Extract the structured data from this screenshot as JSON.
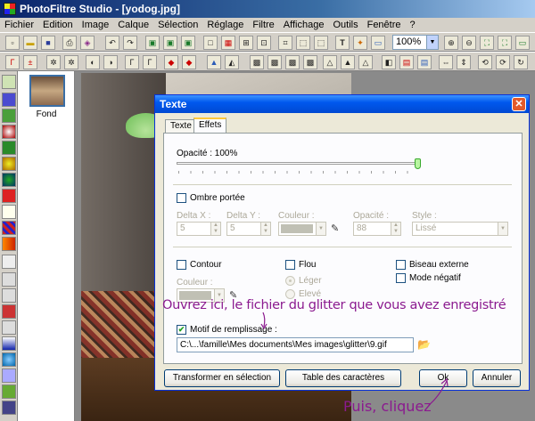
{
  "app": {
    "title": "PhotoFiltre Studio - [yodog.jpg]"
  },
  "menu": [
    "Fichier",
    "Edition",
    "Image",
    "Calque",
    "Sélection",
    "Réglage",
    "Filtre",
    "Affichage",
    "Outils",
    "Fenêtre",
    "?"
  ],
  "toolbar": {
    "zoom_value": "100%"
  },
  "layers": {
    "fond_label": "Fond"
  },
  "dialog": {
    "title": "Texte",
    "close_glyph": "✕",
    "tabs": [
      "Texte",
      "Effets"
    ],
    "opacity_label": "Opacité : 100%",
    "opacity_value": 1.0,
    "shadow": {
      "label": "Ombre portée",
      "checked": false,
      "delta_x_label": "Delta X :",
      "delta_x_value": "5",
      "delta_y_label": "Delta Y :",
      "delta_y_value": "5",
      "color_label": "Couleur :",
      "opacity_label": "Opacité :",
      "opacity_value": "88",
      "style_label": "Style :",
      "style_value": "Lissé"
    },
    "contour_label": "Contour",
    "flou_label": "Flou",
    "biseau_label": "Biseau externe",
    "negatif_label": "Mode négatif",
    "color_label2": "Couleur :",
    "radio_leger": "Léger",
    "radio_eleve": "Elevé",
    "motif": {
      "label": "Motif de remplissage :",
      "checked": true,
      "path": "C:\\...\\famille\\Mes documents\\Mes images\\glitter\\9.gif"
    },
    "buttons": {
      "transformer": "Transformer en sélection",
      "table": "Table des caractères",
      "ok": "Ok",
      "annuler": "Annuler"
    }
  },
  "annotations": {
    "open_here": "Ouvrez ici, le fichier du glitter que vous avez enregistré",
    "then_click": "Puis, cliquez"
  }
}
